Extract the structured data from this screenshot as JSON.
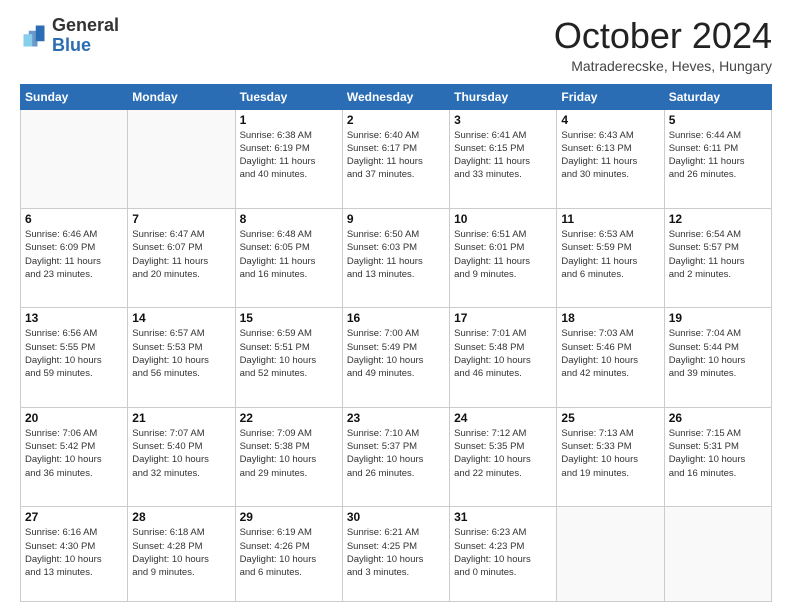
{
  "header": {
    "logo_general": "General",
    "logo_blue": "Blue",
    "month_title": "October 2024",
    "location": "Matraderecske, Heves, Hungary"
  },
  "weekdays": [
    "Sunday",
    "Monday",
    "Tuesday",
    "Wednesday",
    "Thursday",
    "Friday",
    "Saturday"
  ],
  "weeks": [
    [
      {
        "day": "",
        "info": ""
      },
      {
        "day": "",
        "info": ""
      },
      {
        "day": "1",
        "info": "Sunrise: 6:38 AM\nSunset: 6:19 PM\nDaylight: 11 hours\nand 40 minutes."
      },
      {
        "day": "2",
        "info": "Sunrise: 6:40 AM\nSunset: 6:17 PM\nDaylight: 11 hours\nand 37 minutes."
      },
      {
        "day": "3",
        "info": "Sunrise: 6:41 AM\nSunset: 6:15 PM\nDaylight: 11 hours\nand 33 minutes."
      },
      {
        "day": "4",
        "info": "Sunrise: 6:43 AM\nSunset: 6:13 PM\nDaylight: 11 hours\nand 30 minutes."
      },
      {
        "day": "5",
        "info": "Sunrise: 6:44 AM\nSunset: 6:11 PM\nDaylight: 11 hours\nand 26 minutes."
      }
    ],
    [
      {
        "day": "6",
        "info": "Sunrise: 6:46 AM\nSunset: 6:09 PM\nDaylight: 11 hours\nand 23 minutes."
      },
      {
        "day": "7",
        "info": "Sunrise: 6:47 AM\nSunset: 6:07 PM\nDaylight: 11 hours\nand 20 minutes."
      },
      {
        "day": "8",
        "info": "Sunrise: 6:48 AM\nSunset: 6:05 PM\nDaylight: 11 hours\nand 16 minutes."
      },
      {
        "day": "9",
        "info": "Sunrise: 6:50 AM\nSunset: 6:03 PM\nDaylight: 11 hours\nand 13 minutes."
      },
      {
        "day": "10",
        "info": "Sunrise: 6:51 AM\nSunset: 6:01 PM\nDaylight: 11 hours\nand 9 minutes."
      },
      {
        "day": "11",
        "info": "Sunrise: 6:53 AM\nSunset: 5:59 PM\nDaylight: 11 hours\nand 6 minutes."
      },
      {
        "day": "12",
        "info": "Sunrise: 6:54 AM\nSunset: 5:57 PM\nDaylight: 11 hours\nand 2 minutes."
      }
    ],
    [
      {
        "day": "13",
        "info": "Sunrise: 6:56 AM\nSunset: 5:55 PM\nDaylight: 10 hours\nand 59 minutes."
      },
      {
        "day": "14",
        "info": "Sunrise: 6:57 AM\nSunset: 5:53 PM\nDaylight: 10 hours\nand 56 minutes."
      },
      {
        "day": "15",
        "info": "Sunrise: 6:59 AM\nSunset: 5:51 PM\nDaylight: 10 hours\nand 52 minutes."
      },
      {
        "day": "16",
        "info": "Sunrise: 7:00 AM\nSunset: 5:49 PM\nDaylight: 10 hours\nand 49 minutes."
      },
      {
        "day": "17",
        "info": "Sunrise: 7:01 AM\nSunset: 5:48 PM\nDaylight: 10 hours\nand 46 minutes."
      },
      {
        "day": "18",
        "info": "Sunrise: 7:03 AM\nSunset: 5:46 PM\nDaylight: 10 hours\nand 42 minutes."
      },
      {
        "day": "19",
        "info": "Sunrise: 7:04 AM\nSunset: 5:44 PM\nDaylight: 10 hours\nand 39 minutes."
      }
    ],
    [
      {
        "day": "20",
        "info": "Sunrise: 7:06 AM\nSunset: 5:42 PM\nDaylight: 10 hours\nand 36 minutes."
      },
      {
        "day": "21",
        "info": "Sunrise: 7:07 AM\nSunset: 5:40 PM\nDaylight: 10 hours\nand 32 minutes."
      },
      {
        "day": "22",
        "info": "Sunrise: 7:09 AM\nSunset: 5:38 PM\nDaylight: 10 hours\nand 29 minutes."
      },
      {
        "day": "23",
        "info": "Sunrise: 7:10 AM\nSunset: 5:37 PM\nDaylight: 10 hours\nand 26 minutes."
      },
      {
        "day": "24",
        "info": "Sunrise: 7:12 AM\nSunset: 5:35 PM\nDaylight: 10 hours\nand 22 minutes."
      },
      {
        "day": "25",
        "info": "Sunrise: 7:13 AM\nSunset: 5:33 PM\nDaylight: 10 hours\nand 19 minutes."
      },
      {
        "day": "26",
        "info": "Sunrise: 7:15 AM\nSunset: 5:31 PM\nDaylight: 10 hours\nand 16 minutes."
      }
    ],
    [
      {
        "day": "27",
        "info": "Sunrise: 6:16 AM\nSunset: 4:30 PM\nDaylight: 10 hours\nand 13 minutes."
      },
      {
        "day": "28",
        "info": "Sunrise: 6:18 AM\nSunset: 4:28 PM\nDaylight: 10 hours\nand 9 minutes."
      },
      {
        "day": "29",
        "info": "Sunrise: 6:19 AM\nSunset: 4:26 PM\nDaylight: 10 hours\nand 6 minutes."
      },
      {
        "day": "30",
        "info": "Sunrise: 6:21 AM\nSunset: 4:25 PM\nDaylight: 10 hours\nand 3 minutes."
      },
      {
        "day": "31",
        "info": "Sunrise: 6:23 AM\nSunset: 4:23 PM\nDaylight: 10 hours\nand 0 minutes."
      },
      {
        "day": "",
        "info": ""
      },
      {
        "day": "",
        "info": ""
      }
    ]
  ]
}
